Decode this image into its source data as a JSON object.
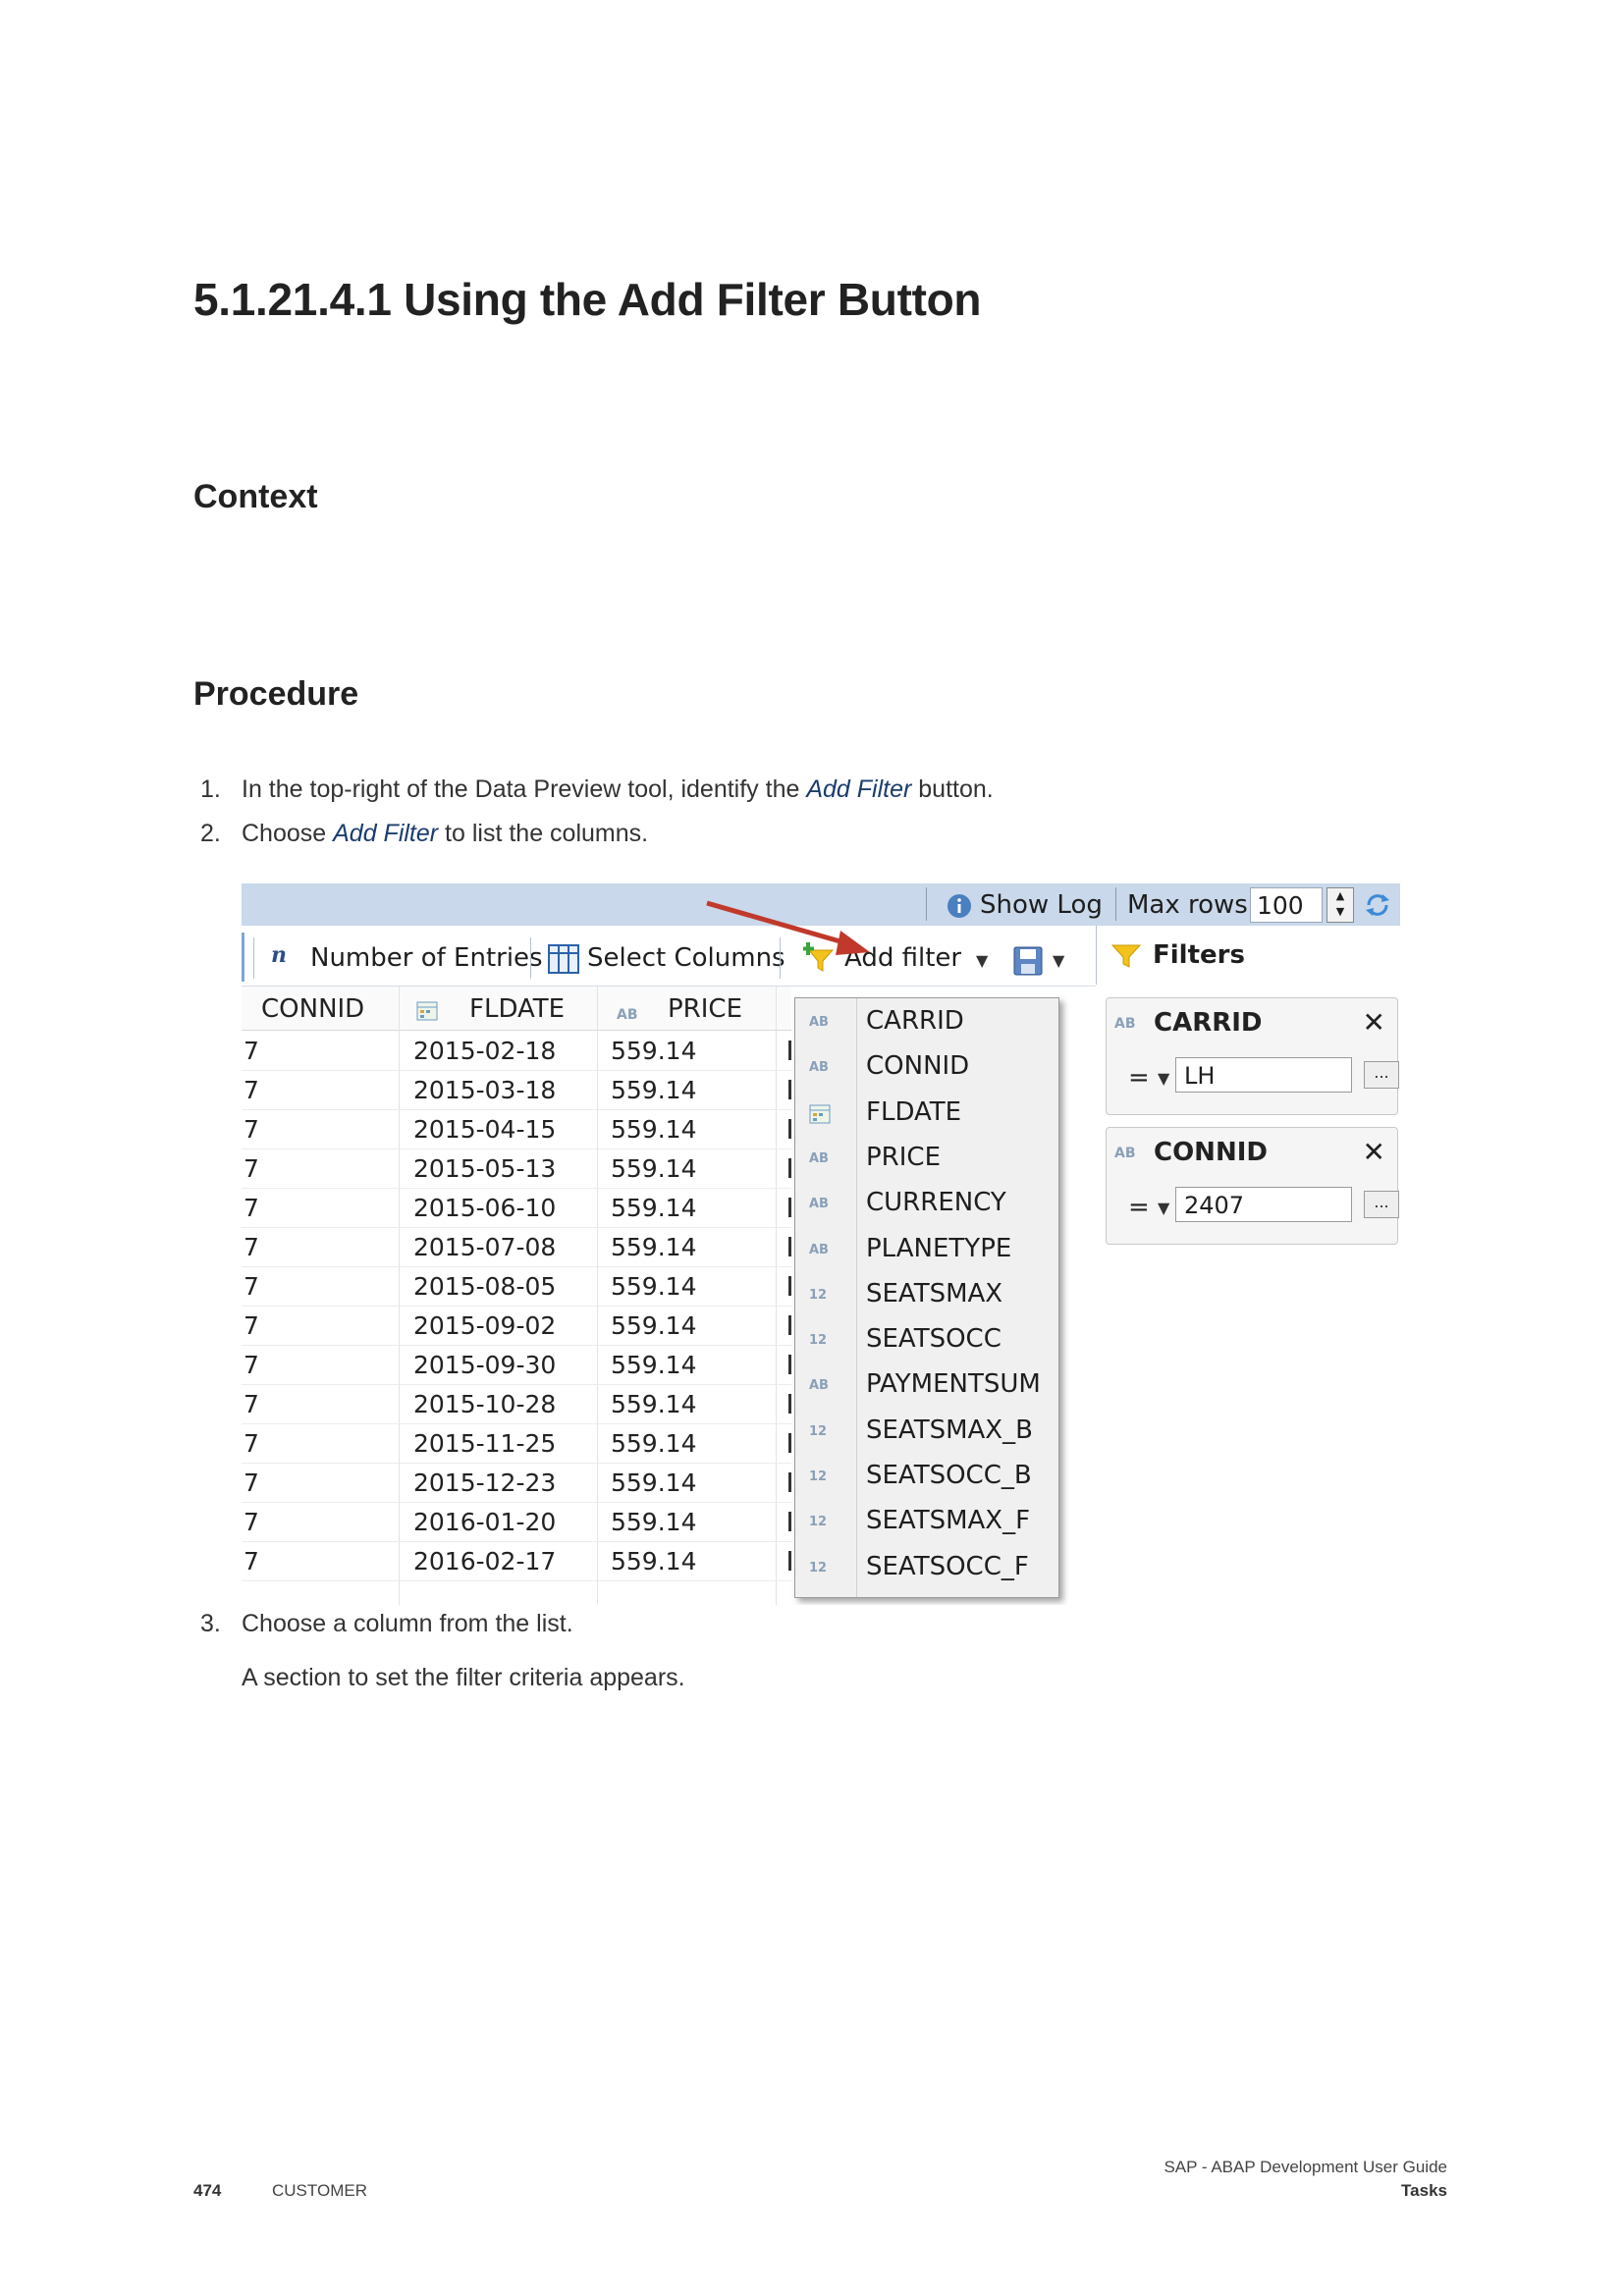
{
  "heading": "5.1.21.4.1  Using the Add Filter Button",
  "sections": {
    "context": "Context",
    "procedure": "Procedure"
  },
  "steps": [
    {
      "num": "1.",
      "pre": "In the top-right of the Data Preview tool, identify the ",
      "link": "Add Filter",
      "post": " button."
    },
    {
      "num": "2.",
      "pre": "Choose ",
      "link": "Add Filter",
      "post": " to list the columns."
    },
    {
      "num": "3.",
      "text": "Choose a column from the list."
    }
  ],
  "step3_sub": "A section to set the filter criteria appears.",
  "screenshot": {
    "top_bar": {
      "show_log": "Show Log",
      "max_rows_label": "Max rows:",
      "max_rows_value": "100"
    },
    "toolbar": {
      "number_of_entries": "Number of Entries",
      "select_columns": "Select Columns",
      "add_filter": "Add filter",
      "filters": "Filters"
    },
    "table": {
      "headers": [
        "CONNID",
        "FLDATE",
        "PRICE"
      ],
      "header_tags": [
        "",
        "",
        "AB"
      ],
      "rows": [
        [
          "7",
          "2015-02-18",
          "559.14"
        ],
        [
          "7",
          "2015-03-18",
          "559.14"
        ],
        [
          "7",
          "2015-04-15",
          "559.14"
        ],
        [
          "7",
          "2015-05-13",
          "559.14"
        ],
        [
          "7",
          "2015-06-10",
          "559.14"
        ],
        [
          "7",
          "2015-07-08",
          "559.14"
        ],
        [
          "7",
          "2015-08-05",
          "559.14"
        ],
        [
          "7",
          "2015-09-02",
          "559.14"
        ],
        [
          "7",
          "2015-09-30",
          "559.14"
        ],
        [
          "7",
          "2015-10-28",
          "559.14"
        ],
        [
          "7",
          "2015-11-25",
          "559.14"
        ],
        [
          "7",
          "2015-12-23",
          "559.14"
        ],
        [
          "7",
          "2016-01-20",
          "559.14"
        ],
        [
          "7",
          "2016-02-17",
          "559.14"
        ]
      ]
    },
    "dropdown": [
      {
        "tag": "AB",
        "label": "CARRID"
      },
      {
        "tag": "AB",
        "label": "CONNID"
      },
      {
        "tag": "",
        "label": "FLDATE"
      },
      {
        "tag": "AB",
        "label": "PRICE"
      },
      {
        "tag": "AB",
        "label": "CURRENCY"
      },
      {
        "tag": "AB",
        "label": "PLANETYPE"
      },
      {
        "tag": "12",
        "label": "SEATSMAX"
      },
      {
        "tag": "12",
        "label": "SEATSOCC"
      },
      {
        "tag": "AB",
        "label": "PAYMENTSUM"
      },
      {
        "tag": "12",
        "label": "SEATSMAX_B"
      },
      {
        "tag": "12",
        "label": "SEATSOCC_B"
      },
      {
        "tag": "12",
        "label": "SEATSMAX_F"
      },
      {
        "tag": "12",
        "label": "SEATSOCC_F"
      }
    ],
    "filter_cards": [
      {
        "tag": "AB",
        "title": "CARRID",
        "operator": "=",
        "value": "LH",
        "more": "...",
        "close": "✕"
      },
      {
        "tag": "AB",
        "title": "CONNID",
        "operator": "=",
        "value": "2407",
        "more": "...",
        "close": "✕"
      }
    ]
  },
  "footer": {
    "page_number": "474",
    "classification": "CUSTOMER",
    "doc_title": "SAP - ABAP Development User Guide",
    "section": "Tasks"
  }
}
